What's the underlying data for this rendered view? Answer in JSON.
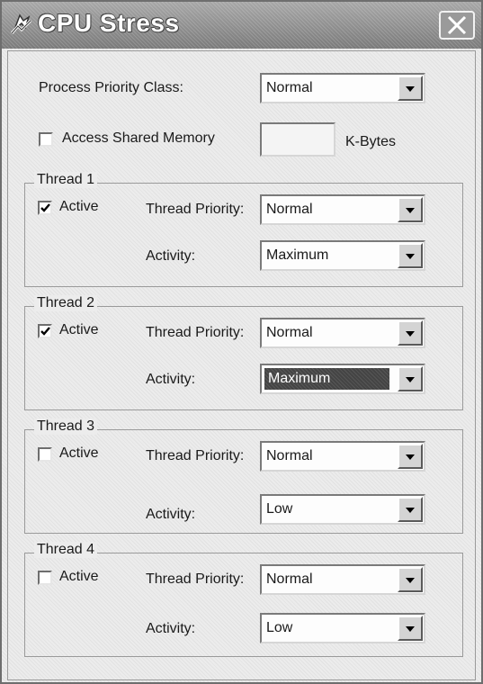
{
  "window": {
    "title": "CPU Stress",
    "icon": "cpu-stress-app-icon",
    "close_icon": "close-icon"
  },
  "process": {
    "priority_label": "Process Priority Class:",
    "priority_value": "Normal",
    "shared_memory_label": "Access Shared Memory",
    "shared_memory_checked": false,
    "shared_memory_value": "",
    "shared_memory_unit": "K-Bytes"
  },
  "labels": {
    "active": "Active",
    "thread_priority": "Thread Priority:",
    "activity": "Activity:"
  },
  "threads": [
    {
      "title": "Thread 1",
      "active": true,
      "priority": "Normal",
      "activity": "Maximum"
    },
    {
      "title": "Thread 2",
      "active": true,
      "priority": "Normal",
      "activity": "Maximum",
      "activity_focused": true
    },
    {
      "title": "Thread 3",
      "active": false,
      "priority": "Normal",
      "activity": "Low"
    },
    {
      "title": "Thread 4",
      "active": false,
      "priority": "Normal",
      "activity": "Low"
    }
  ],
  "colors": {
    "titlebar": "#8d8d8d",
    "face": "#ececec",
    "highlight": "#444444"
  }
}
